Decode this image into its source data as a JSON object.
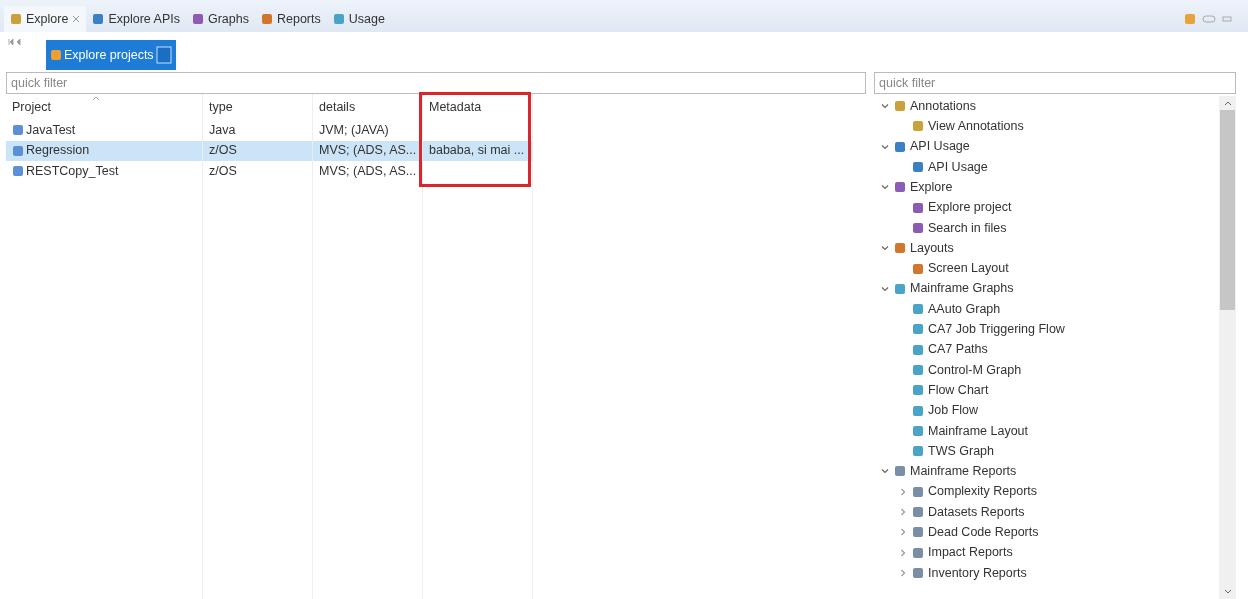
{
  "tabs": [
    {
      "label": "Explore",
      "selected": true,
      "closable": true
    },
    {
      "label": "Explore APIs",
      "selected": false,
      "closable": false
    },
    {
      "label": "Graphs",
      "selected": false,
      "closable": false
    },
    {
      "label": "Reports",
      "selected": false,
      "closable": false
    },
    {
      "label": "Usage",
      "selected": false,
      "closable": false
    }
  ],
  "toolbar": {
    "items": [
      {
        "label": "Explore projects",
        "selected": true
      }
    ]
  },
  "left_filter": {
    "placeholder": "quick filter"
  },
  "table": {
    "columns": [
      {
        "label": "Project",
        "sorted": true,
        "highlighted": false
      },
      {
        "label": "type",
        "sorted": false,
        "highlighted": false
      },
      {
        "label": "details",
        "sorted": false,
        "highlighted": false
      },
      {
        "label": "Metadata",
        "sorted": false,
        "highlighted": true
      }
    ],
    "rows": [
      {
        "cells": [
          "JavaTest",
          "Java",
          "JVM;  (JAVA)",
          ""
        ],
        "selected": false
      },
      {
        "cells": [
          "Regression",
          "z/OS",
          "MVS;  (ADS, AS...",
          "bababa, si mai ..."
        ],
        "selected": true
      },
      {
        "cells": [
          "RESTCopy_Test",
          "z/OS",
          "MVS;  (ADS, AS...",
          ""
        ],
        "selected": false
      }
    ]
  },
  "right_filter": {
    "placeholder": "quick filter"
  },
  "tree": [
    {
      "label": "Annotations",
      "expanded": true,
      "children": [
        {
          "label": "View Annotations"
        }
      ]
    },
    {
      "label": "API Usage",
      "expanded": true,
      "children": [
        {
          "label": "API Usage"
        }
      ]
    },
    {
      "label": "Explore",
      "expanded": true,
      "children": [
        {
          "label": "Explore project"
        },
        {
          "label": "Search in files"
        }
      ]
    },
    {
      "label": "Layouts",
      "expanded": true,
      "children": [
        {
          "label": "Screen Layout"
        }
      ]
    },
    {
      "label": "Mainframe Graphs",
      "expanded": true,
      "children": [
        {
          "label": "AAuto Graph"
        },
        {
          "label": "CA7 Job Triggering Flow"
        },
        {
          "label": "CA7 Paths"
        },
        {
          "label": "Control-M Graph"
        },
        {
          "label": "Flow Chart"
        },
        {
          "label": "Job Flow"
        },
        {
          "label": "Mainframe Layout"
        },
        {
          "label": "TWS Graph"
        }
      ]
    },
    {
      "label": "Mainframe Reports",
      "expanded": true,
      "children": [
        {
          "label": "Complexity Reports",
          "expanded": false
        },
        {
          "label": "Datasets Reports",
          "expanded": false
        },
        {
          "label": "Dead Code Reports",
          "expanded": false
        },
        {
          "label": "Impact Reports",
          "expanded": false
        },
        {
          "label": "Inventory Reports",
          "expanded": false
        }
      ]
    }
  ]
}
